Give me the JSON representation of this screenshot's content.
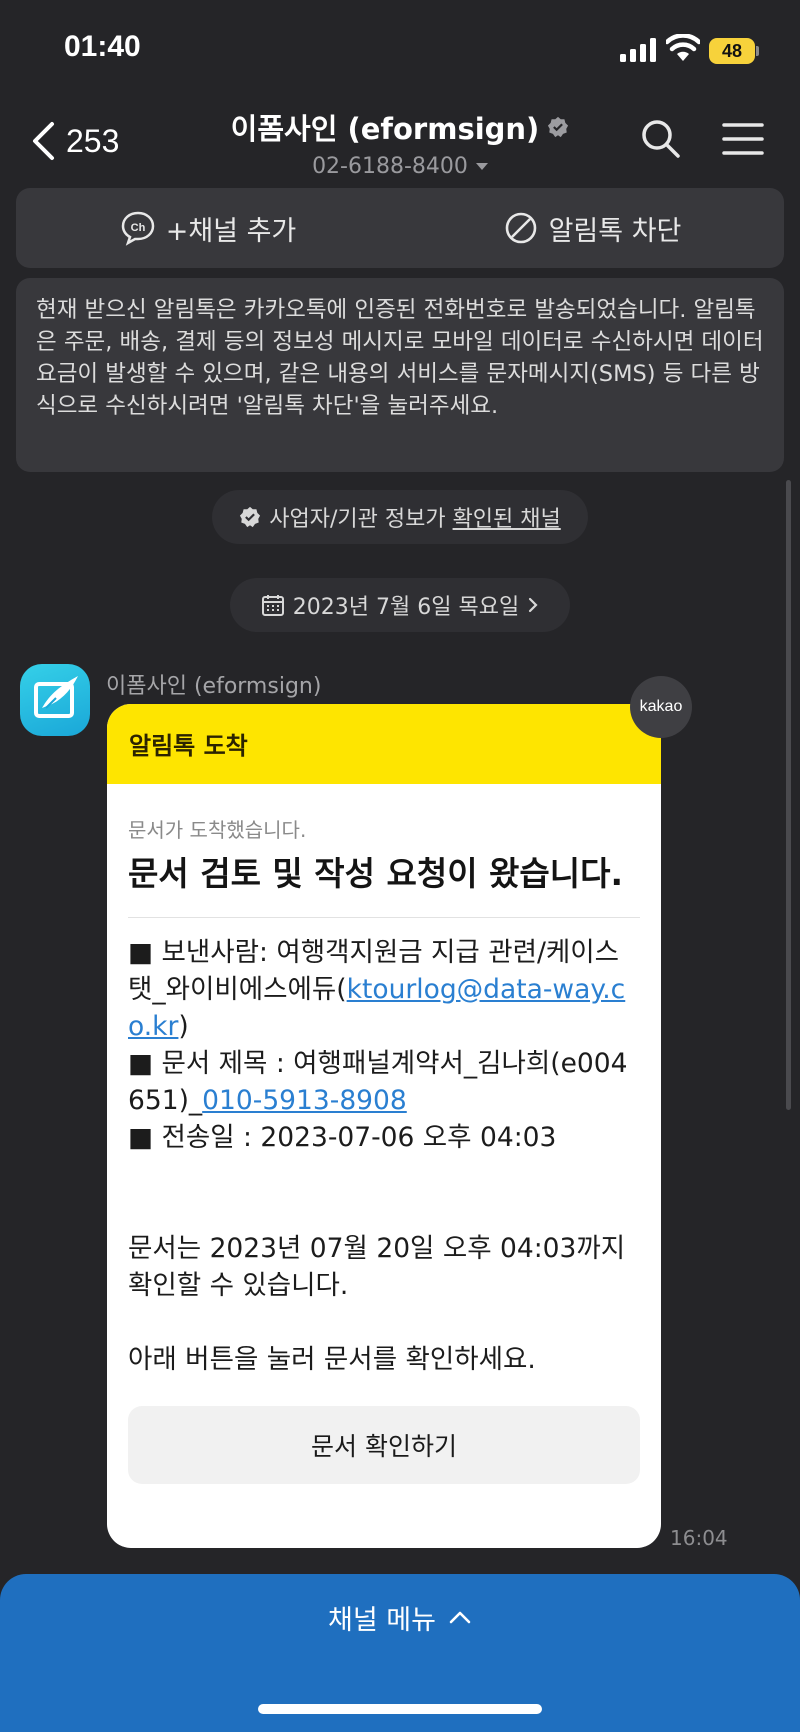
{
  "status_bar": {
    "time": "01:40",
    "battery": "48"
  },
  "header": {
    "back_count": "253",
    "title": "이폼사인 (eformsign)",
    "phone": "02-6188-8400"
  },
  "actions": {
    "add_channel": "+채널 추가",
    "block": "알림톡 차단"
  },
  "notice": "현재 받으신 알림톡은 카카오톡에 인증된 전화번호로 발송되었습니다. 알림톡은 주문, 배송, 결제 등의 정보성 메시지로 모바일 데이터로 수신하시면 데이터요금이 발생할 수 있으며, 같은 내용의 서비스를 문자메시지(SMS) 등 다른 방식으로 수신하시려면 '알림톡 차단'을 눌러주세요.",
  "verify_pill": {
    "prefix": "사업자/기관 정보가 ",
    "link": "확인된 채널"
  },
  "date_pill": "2023년 7월 6일 목요일",
  "message": {
    "sender": "이폼사인 (eformsign)",
    "badge": "kakao",
    "header": "알림톡 도착",
    "subtitle": "문서가 도착했습니다.",
    "title": "문서 검토 및 작성 요청이 왔습니다.",
    "sender_line_prefix": "■ 보낸사람: 여행객지원금 지급 관련/케이스탯_와이비에스에듀(",
    "sender_email": "ktourlog@data-way.co.kr",
    "sender_line_suffix": ")",
    "doc_title_prefix": "■ 문서 제목 : 여행패널계약서_김나희(e004651)_",
    "doc_title_phone": "010-5913-8908",
    "sent_date": "■ 전송일 : 2023-07-06 오후 04:03",
    "deadline": "문서는 2023년 07월 20일 오후 04:03까지 확인할 수 있습니다.",
    "instruction": "아래 버튼을 눌러 문서를 확인하세요.",
    "button": "문서 확인하기",
    "time": "16:04"
  },
  "channel_menu": "채널 메뉴"
}
